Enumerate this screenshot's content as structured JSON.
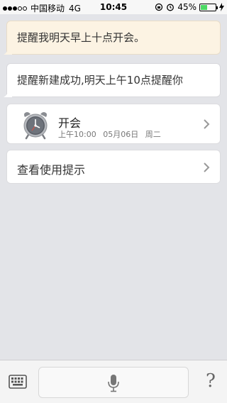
{
  "status_bar": {
    "carrier": "中国移动",
    "network": "4G",
    "time": "10:45",
    "battery_percent": "45%",
    "battery_level": 0.45
  },
  "conversation": {
    "user_message": "提醒我明天早上十点开会。",
    "assistant_reply": "提醒新建成功,明天上午10点提醒你"
  },
  "reminder": {
    "title": "开会",
    "time": "上午10:00",
    "date": "05月06日",
    "weekday": "周二"
  },
  "tips": {
    "label": "查看使用提示"
  },
  "bottom_bar": {
    "help_label": "?"
  },
  "icons": {
    "alarm": "alarm-clock-icon",
    "keyboard": "keyboard-icon",
    "mic": "microphone-icon",
    "chevron": "chevron-right-icon"
  },
  "colors": {
    "user_bubble": "#fcf3e3",
    "battery": "#4cd964",
    "background": "#e3e4e8"
  }
}
